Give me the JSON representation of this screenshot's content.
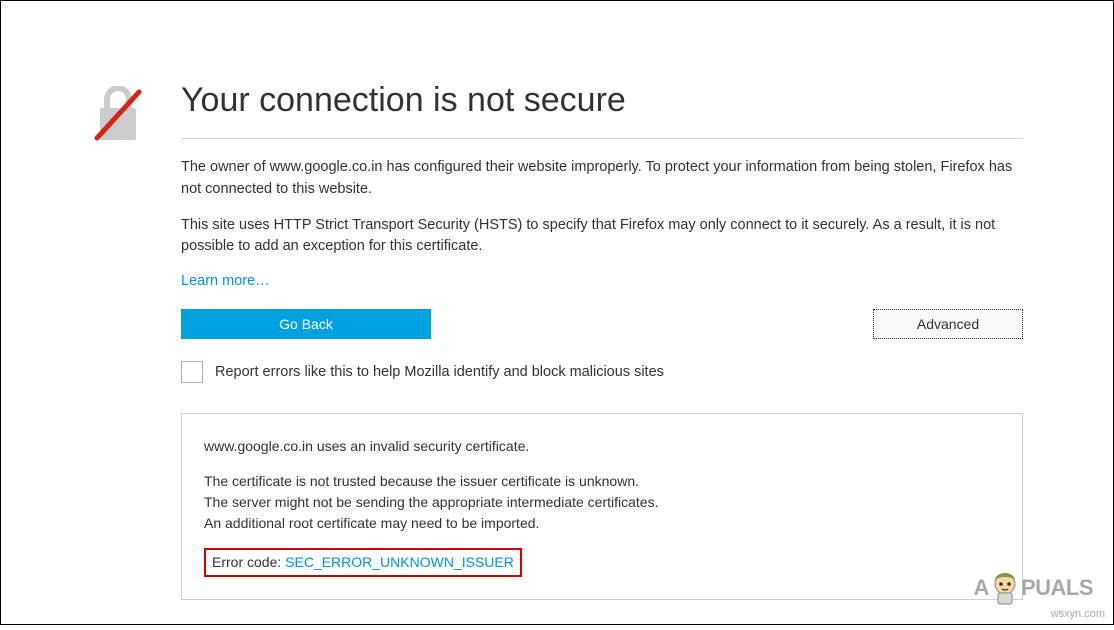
{
  "title": "Your connection is not secure",
  "description1": "The owner of www.google.co.in has configured their website improperly. To protect your information from being stolen, Firefox has not connected to this website.",
  "description2": "This site uses HTTP Strict Transport Security (HSTS) to specify that Firefox may only connect to it securely. As a result, it is not possible to add an exception for this certificate.",
  "learnMore": "Learn more…",
  "buttons": {
    "goBack": "Go Back",
    "advanced": "Advanced"
  },
  "checkbox": {
    "label": "Report errors like this to help Mozilla identify and block malicious sites"
  },
  "details": {
    "line1": "www.google.co.in uses an invalid security certificate.",
    "line2a": "The certificate is not trusted because the issuer certificate is unknown.",
    "line2b": "The server might not be sending the appropriate intermediate certificates.",
    "line2c": "An additional root certificate may need to be imported.",
    "errorLabel": "Error code: ",
    "errorCode": "SEC_ERROR_UNKNOWN_ISSUER"
  },
  "branding": {
    "logoPre": "A",
    "logoPost": "PUALS",
    "watermark": "wsxyn.com"
  }
}
